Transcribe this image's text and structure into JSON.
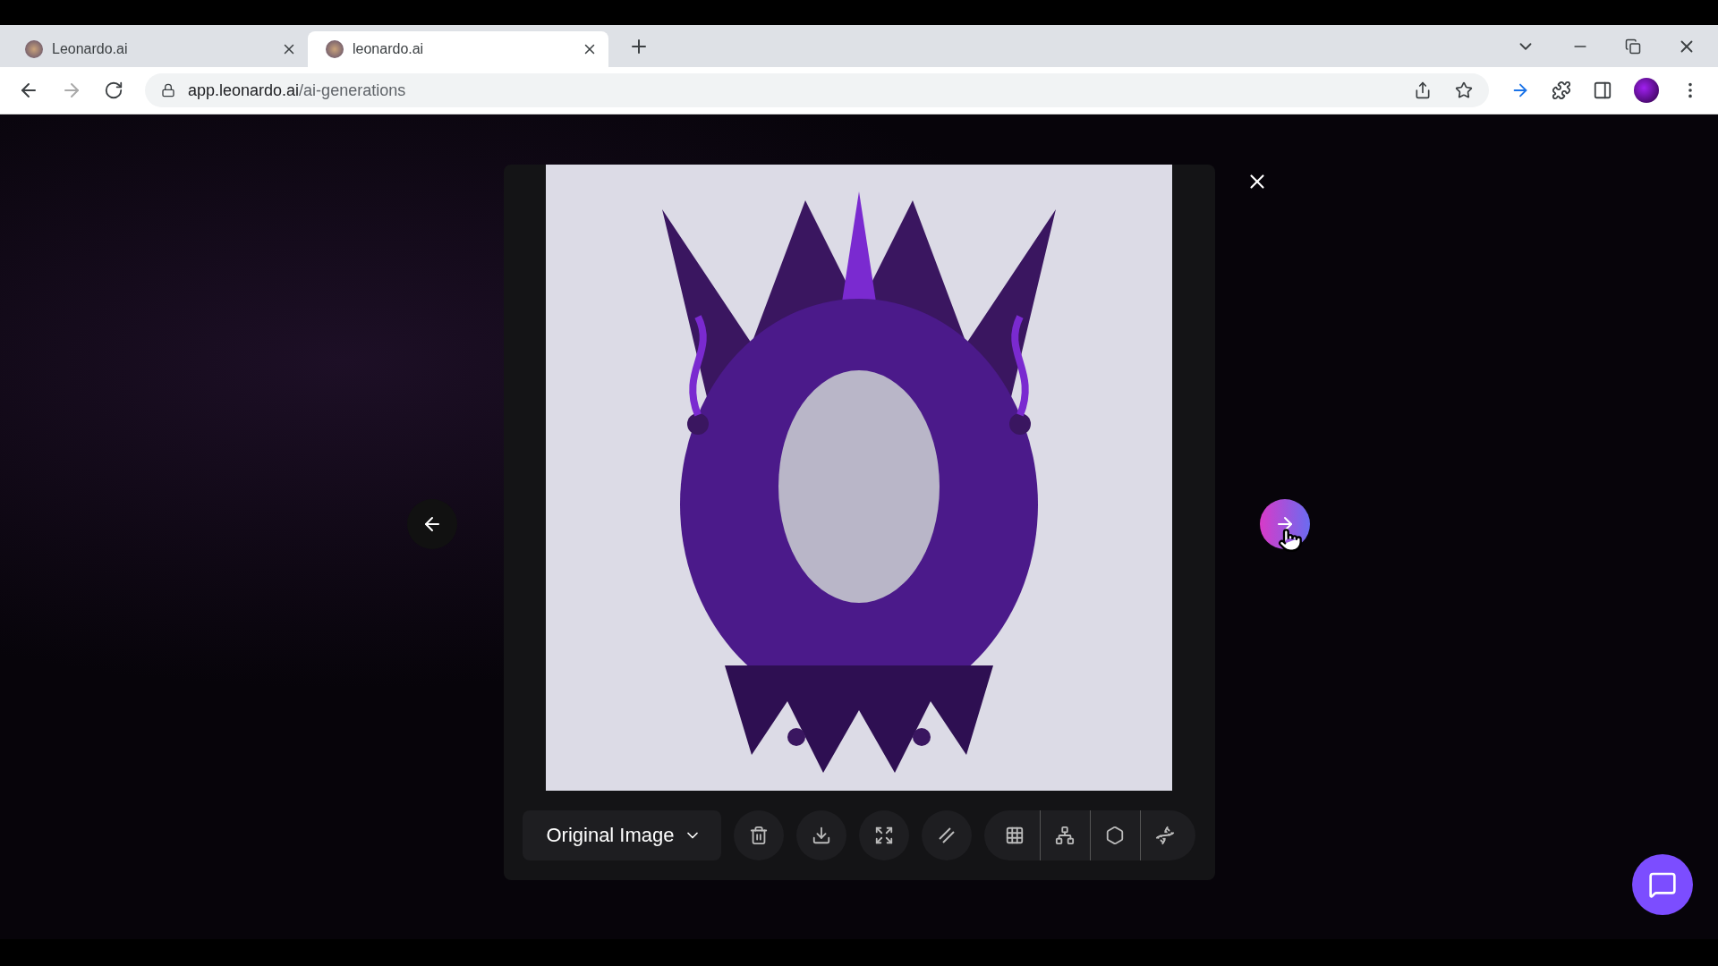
{
  "browser": {
    "tabs": [
      {
        "title": "Leonardo.ai",
        "selected": false
      },
      {
        "title": "leonardo.ai",
        "selected": true
      }
    ],
    "address": {
      "host": "app.leonardo.ai",
      "path": "/ai-generations"
    }
  },
  "viewer": {
    "version_select": {
      "value": "Original Image"
    }
  }
}
